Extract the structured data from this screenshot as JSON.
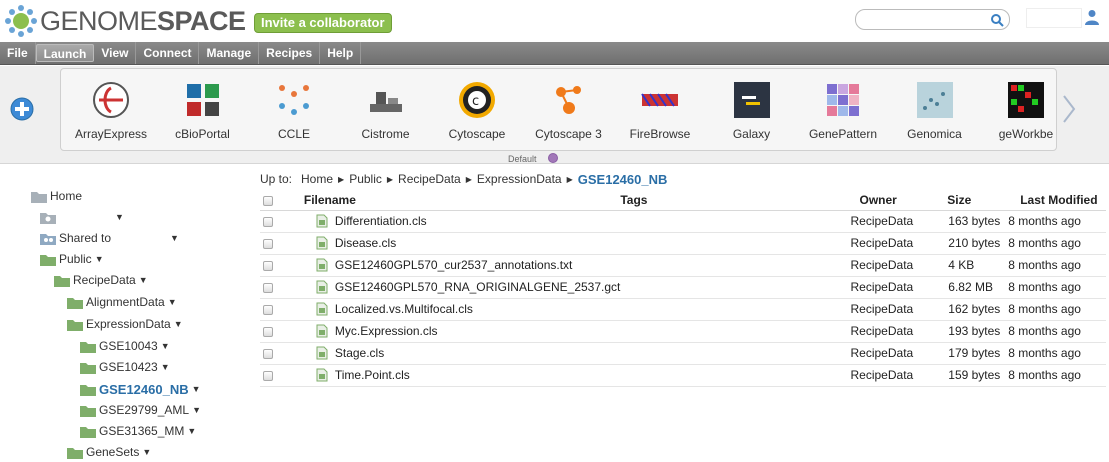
{
  "header": {
    "logo_light": "GENOME",
    "logo_bold": "SPACE",
    "invite_label": "Invite a collaborator",
    "search_placeholder": ""
  },
  "menu": [
    "File",
    "Launch",
    "View",
    "Connect",
    "Manage",
    "Recipes",
    "Help"
  ],
  "menu_active": "Launch",
  "apps": [
    {
      "label": "ArrayExpress",
      "icon": "arrayexpress-icon"
    },
    {
      "label": "cBioPortal",
      "icon": "cbioportal-icon"
    },
    {
      "label": "CCLE",
      "icon": "ccle-icon"
    },
    {
      "label": "Cistrome",
      "icon": "cistrome-icon"
    },
    {
      "label": "Cytoscape",
      "icon": "cytoscape-icon"
    },
    {
      "label": "Cytoscape 3",
      "icon": "cytoscape3-icon"
    },
    {
      "label": "FireBrowse",
      "icon": "firebrowse-icon"
    },
    {
      "label": "Galaxy",
      "icon": "galaxy-icon"
    },
    {
      "label": "GenePattern",
      "icon": "genepattern-icon"
    },
    {
      "label": "Genomica",
      "icon": "genomica-icon"
    },
    {
      "label": "geWorkbe",
      "icon": "geworkbench-icon"
    }
  ],
  "launch_default_label": "Default",
  "tree": {
    "home": "Home",
    "home_child": "",
    "shared": "Shared to",
    "public": "Public",
    "recipedata": "RecipeData",
    "alignmentdata": "AlignmentData",
    "expressiondata": "ExpressionData",
    "gse10043": "GSE10043",
    "gse10423": "GSE10423",
    "gse12460": "GSE12460_NB",
    "gse29799": "GSE29799_AML",
    "gse31365": "GSE31365_MM",
    "genesets": "GeneSets"
  },
  "breadcrumb": {
    "prefix": "Up to:",
    "items": [
      "Home",
      "Public",
      "RecipeData",
      "ExpressionData"
    ],
    "current": "GSE12460_NB"
  },
  "table": {
    "headers": {
      "filename": "Filename",
      "tags": "Tags",
      "owner": "Owner",
      "size": "Size",
      "modified": "Last Modified"
    },
    "rows": [
      {
        "filename": "Differentiation.cls",
        "owner": "RecipeData",
        "size": "163 bytes",
        "modified": "8 months ago"
      },
      {
        "filename": "Disease.cls",
        "owner": "RecipeData",
        "size": "210 bytes",
        "modified": "8 months ago"
      },
      {
        "filename": "GSE12460GPL570_cur2537_annotations.txt",
        "owner": "RecipeData",
        "size": "4 KB",
        "modified": "8 months ago"
      },
      {
        "filename": "GSE12460GPL570_RNA_ORIGINALGENE_2537.gct",
        "owner": "RecipeData",
        "size": "6.82 MB",
        "modified": "8 months ago"
      },
      {
        "filename": "Localized.vs.Multifocal.cls",
        "owner": "RecipeData",
        "size": "162 bytes",
        "modified": "8 months ago"
      },
      {
        "filename": "Myc.Expression.cls",
        "owner": "RecipeData",
        "size": "193 bytes",
        "modified": "8 months ago"
      },
      {
        "filename": "Stage.cls",
        "owner": "RecipeData",
        "size": "179 bytes",
        "modified": "8 months ago"
      },
      {
        "filename": "Time.Point.cls",
        "owner": "RecipeData",
        "size": "159 bytes",
        "modified": "8 months ago"
      }
    ]
  },
  "colors": {
    "accent": "#2a6ea6",
    "invite": "#8cbf4e",
    "menubar": "#7a7a7a"
  }
}
